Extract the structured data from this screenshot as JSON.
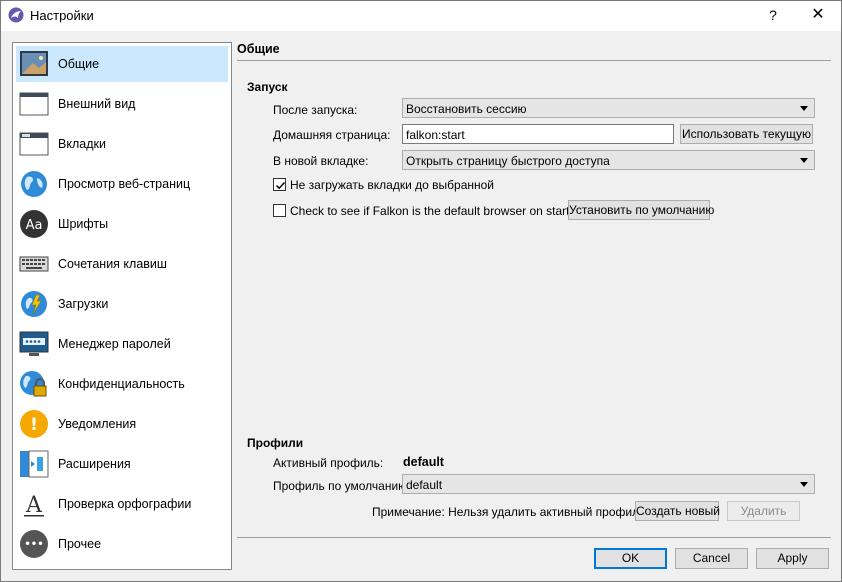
{
  "window": {
    "title": "Настройки",
    "help_glyph": "?",
    "close_glyph": "✕"
  },
  "sidebar": {
    "items": [
      {
        "label": "Общие",
        "icon": "general-icon",
        "selected": true
      },
      {
        "label": "Внешний вид",
        "icon": "appearance-icon"
      },
      {
        "label": "Вкладки",
        "icon": "tabs-icon"
      },
      {
        "label": "Просмотр веб-страниц",
        "icon": "globe-icon"
      },
      {
        "label": "Шрифты",
        "icon": "fonts-icon",
        "glyph": "Aa"
      },
      {
        "label": "Сочетания клавиш",
        "icon": "keyboard-icon"
      },
      {
        "label": "Загрузки",
        "icon": "downloads-icon"
      },
      {
        "label": "Менеджер паролей",
        "icon": "password-manager-icon"
      },
      {
        "label": "Конфиденциальность",
        "icon": "privacy-icon"
      },
      {
        "label": "Уведомления",
        "icon": "notifications-icon",
        "glyph": "!"
      },
      {
        "label": "Расширения",
        "icon": "extensions-icon"
      },
      {
        "label": "Проверка орфографии",
        "icon": "spellcheck-icon",
        "glyph": "A"
      },
      {
        "label": "Прочее",
        "icon": "other-icon",
        "glyph": "•••"
      }
    ]
  },
  "page": {
    "title": "Общие",
    "startup": {
      "section": "Запуск",
      "after_launch_label": "После запуска:",
      "after_launch_value": "Восстановить сессию",
      "homepage_label": "Домашняя страница:",
      "homepage_value": "falkon:start",
      "use_current_button": "Использовать текущую",
      "new_tab_label": "В новой вкладке:",
      "new_tab_value": "Открыть страницу быстрого доступа",
      "dont_load_tabs_label": "Не загружать вкладки до выбранной",
      "dont_load_tabs_checked": true,
      "default_browser_label": "Check to see if Falkon is the default browser on startup",
      "default_browser_checked": false,
      "set_default_button": "Установить по умолчанию"
    },
    "profiles": {
      "section": "Профили",
      "active_label": "Активный профиль:",
      "active_value": "default",
      "default_label": "Профиль по умолчанию:",
      "default_value": "default",
      "note": "Примечание: Нельзя удалить активный профиль.",
      "create_button": "Создать новый",
      "delete_button": "Удалить"
    }
  },
  "footer": {
    "ok": "OK",
    "cancel": "Cancel",
    "apply": "Apply"
  },
  "colors": {
    "selection": "#cce8ff",
    "default_button_border": "#0078d7"
  }
}
